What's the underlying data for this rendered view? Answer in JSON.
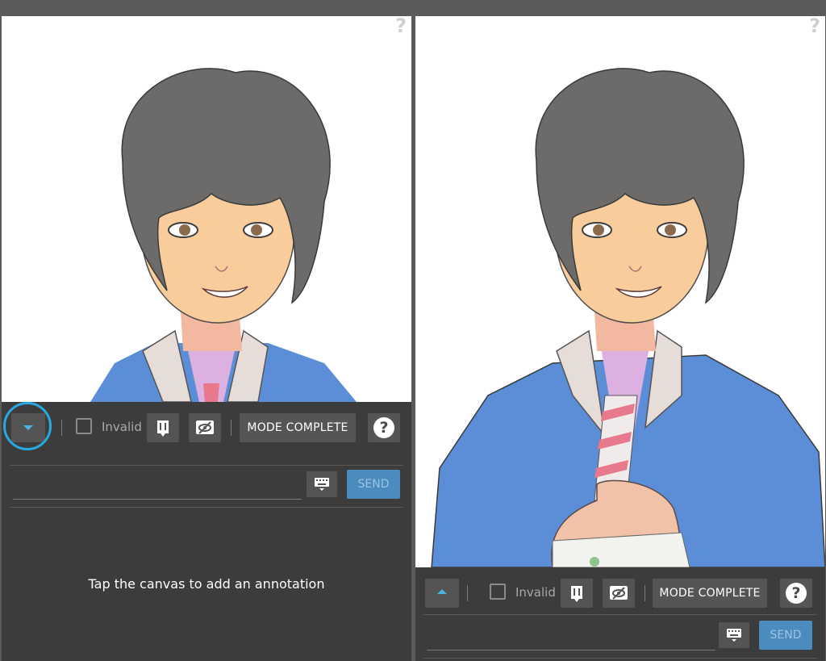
{
  "left_panel": {
    "canvas": {
      "help_glyph": "?"
    },
    "toolbar": {
      "toggle_icon": "chevron-down-icon",
      "invalid_label": "Invalid",
      "delete_icon": "delete-annotation-icon",
      "hide_icon": "hide-annotations-icon",
      "mode_label": "MODE COMPLETE",
      "help_glyph": "?",
      "input_value": "",
      "keyboard_icon": "keyboard-icon",
      "send_label": "SEND",
      "hint": "Tap the canvas to add an annotation"
    }
  },
  "right_panel": {
    "canvas": {
      "help_glyph": "?"
    },
    "toolbar": {
      "toggle_icon": "chevron-up-icon",
      "invalid_label": "Invalid",
      "delete_icon": "delete-annotation-icon",
      "hide_icon": "hide-annotations-icon",
      "mode_label": "MODE COMPLETE",
      "help_glyph": "?",
      "input_value": "",
      "keyboard_icon": "keyboard-icon",
      "send_label": "SEND"
    }
  },
  "colors": {
    "accent": "#29a9e1",
    "send_button": "#4a8cbd",
    "toolbar_bg": "#3c3c3c"
  }
}
